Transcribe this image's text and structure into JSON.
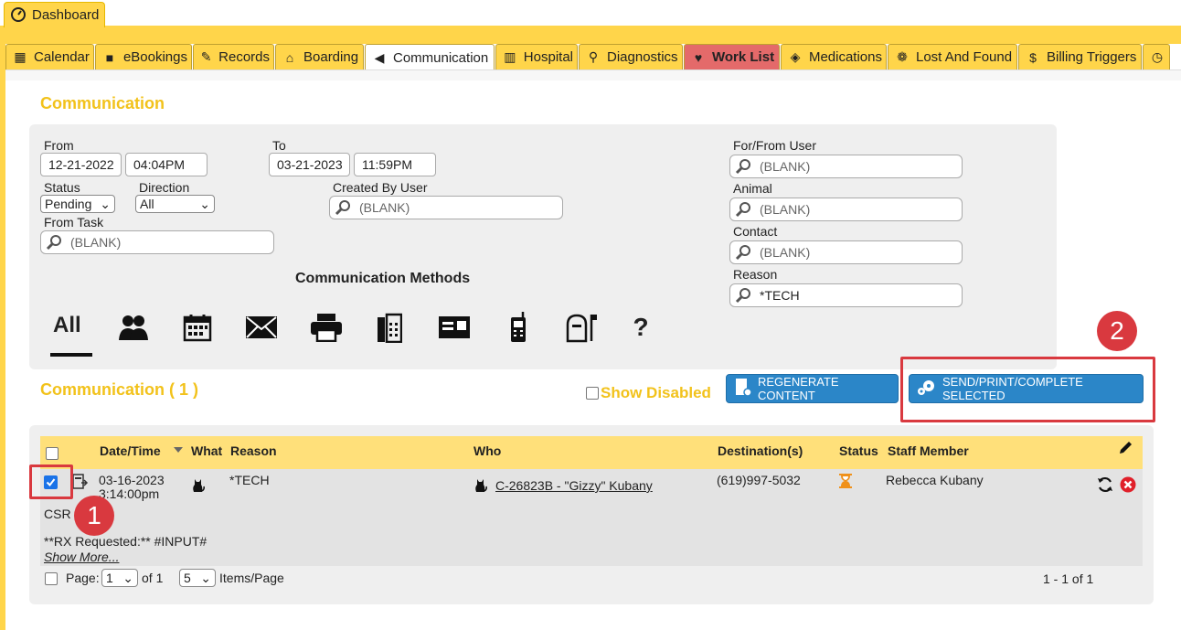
{
  "dashboard_tab": {
    "label": "Dashboard"
  },
  "nav_tabs": [
    {
      "label": "Calendar",
      "icon": "calendar-icon"
    },
    {
      "label": "eBookings",
      "icon": "book-icon"
    },
    {
      "label": "Records",
      "icon": "records-icon"
    },
    {
      "label": "Boarding",
      "icon": "house-icon"
    },
    {
      "label": "Communication",
      "icon": "megaphone-icon",
      "active": true
    },
    {
      "label": "Hospital",
      "icon": "hospital-icon"
    },
    {
      "label": "Diagnostics",
      "icon": "microscope-icon"
    },
    {
      "label": "Work List",
      "icon": "heart-icon",
      "highlight": true
    },
    {
      "label": "Medications",
      "icon": "tag-icon"
    },
    {
      "label": "Lost And Found",
      "icon": "paw-icon"
    },
    {
      "label": "Billing Triggers",
      "icon": "dollar-icon"
    },
    {
      "label": "",
      "icon": "clock-icon"
    }
  ],
  "filters": {
    "title": "Communication",
    "from_label": "From",
    "from_date": "12-21-2022",
    "from_time": "04:04PM",
    "to_label": "To",
    "to_date": "03-21-2023",
    "to_time": "11:59PM",
    "status_label": "Status",
    "status_value": "Pending",
    "direction_label": "Direction",
    "direction_value": "All",
    "created_by_label": "Created By User",
    "created_by_value": "(BLANK)",
    "from_task_label": "From Task",
    "from_task_value": "(BLANK)",
    "for_from_user_label": "For/From User",
    "for_from_user_value": "(BLANK)",
    "animal_label": "Animal",
    "animal_value": "(BLANK)",
    "contact_label": "Contact",
    "contact_value": "(BLANK)",
    "reason_label": "Reason",
    "reason_value": "*TECH",
    "methods_title": "Communication Methods",
    "method_all": "All",
    "methods": [
      "people-icon",
      "calendar-icon",
      "envelope-icon",
      "printer-icon",
      "fax-icon",
      "card-icon",
      "cellphone-icon",
      "mailbox-icon",
      "question-icon"
    ]
  },
  "list": {
    "title": "Communication ( 1 )",
    "show_disabled": "Show Disabled",
    "regenerate_label": "REGENERATE CONTENT",
    "send_label": "SEND/PRINT/COMPLETE SELECTED",
    "annotation_1": "1",
    "annotation_2": "2",
    "columns": [
      "Date/Time",
      "What",
      "Reason",
      "Who",
      "Destination(s)",
      "Status",
      "Staff Member"
    ],
    "row": {
      "date": "03-16-2023",
      "time": "3:14:00pm",
      "reason": "*TECH",
      "who": "C-26823B - \"Gizzy\" Kubany",
      "destination": "(619)997-5032",
      "staff": "Rebecca Kubany",
      "csr": "CSR",
      "content": "**RX Requested:** #INPUT#",
      "show_more": "Show More..."
    },
    "page_label": "Page:",
    "page_value": "1",
    "page_of": "of 1",
    "per_page_value": "5",
    "per_page_label": "Items/Page",
    "range": "1 - 1 of 1"
  },
  "colors": {
    "accent": "#ffd54a",
    "title": "#f2c21b",
    "button": "#2b86c8",
    "annotation": "#d9393f"
  }
}
